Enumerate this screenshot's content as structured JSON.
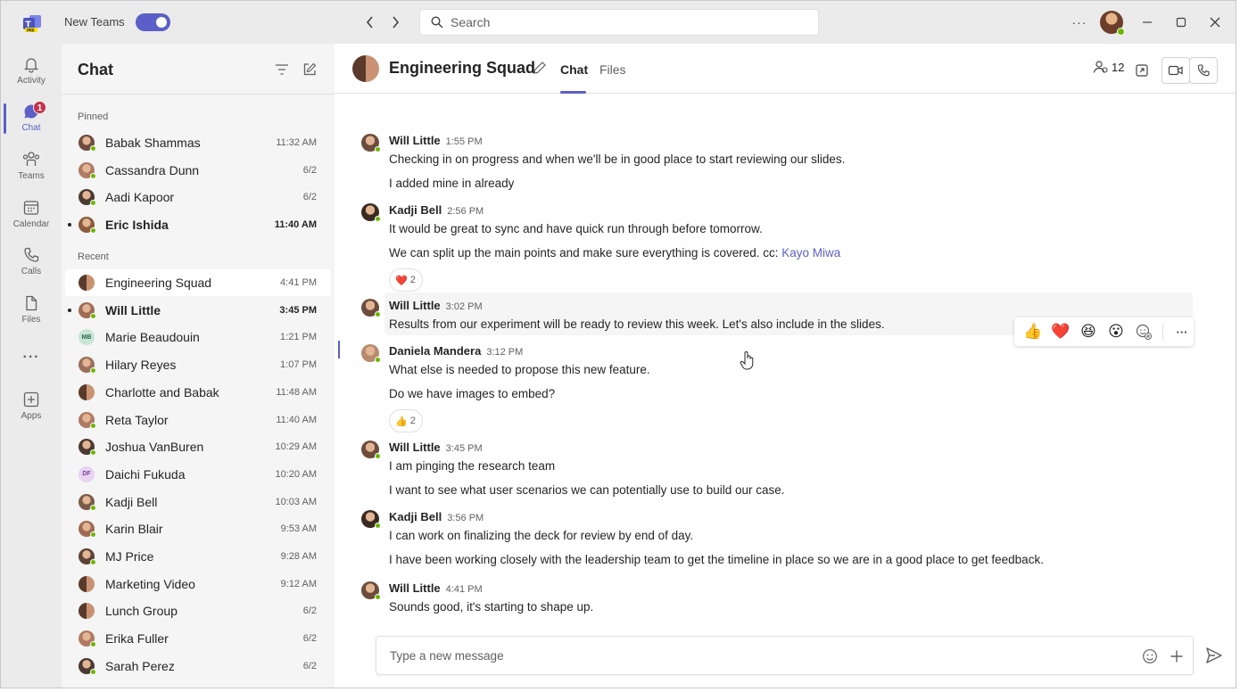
{
  "titlebar": {
    "new_teams_label": "New Teams",
    "search_placeholder": "Search",
    "more_label": "···"
  },
  "rail": {
    "items": [
      {
        "label": "Activity",
        "icon": "bell-icon"
      },
      {
        "label": "Chat",
        "icon": "chat-icon",
        "badge": "1"
      },
      {
        "label": "Teams",
        "icon": "teams-icon"
      },
      {
        "label": "Calendar",
        "icon": "calendar-icon"
      },
      {
        "label": "Calls",
        "icon": "phone-icon"
      },
      {
        "label": "Files",
        "icon": "file-icon"
      },
      {
        "label": "···",
        "icon": "more-icon"
      },
      {
        "label": "Apps",
        "icon": "apps-add-icon"
      }
    ]
  },
  "chatlist": {
    "title": "Chat",
    "pinned_label": "Pinned",
    "recent_label": "Recent",
    "pinned": [
      {
        "name": "Babak Shammas",
        "time": "11:32 AM"
      },
      {
        "name": "Cassandra Dunn",
        "time": "6/2"
      },
      {
        "name": "Aadi Kapoor",
        "time": "6/2"
      },
      {
        "name": "Eric Ishida",
        "time": "11:40 AM",
        "unread": true
      }
    ],
    "recent": [
      {
        "name": "Engineering Squad",
        "time": "4:41 PM",
        "selected": true
      },
      {
        "name": "Will Little",
        "time": "3:45 PM",
        "unread": true
      },
      {
        "name": "Marie Beaudouin",
        "time": "1:21 PM",
        "initials": "MB"
      },
      {
        "name": "Hilary Reyes",
        "time": "1:07 PM"
      },
      {
        "name": "Charlotte and Babak",
        "time": "11:48 AM"
      },
      {
        "name": "Reta Taylor",
        "time": "11:40 AM"
      },
      {
        "name": "Joshua VanBuren",
        "time": "10:29 AM"
      },
      {
        "name": "Daichi Fukuda",
        "time": "10:20 AM",
        "initials": "DF"
      },
      {
        "name": "Kadji Bell",
        "time": "10:03 AM"
      },
      {
        "name": "Karin Blair",
        "time": "9:53 AM"
      },
      {
        "name": "MJ Price",
        "time": "9:28 AM"
      },
      {
        "name": "Marketing Video",
        "time": "9:12 AM"
      },
      {
        "name": "Lunch Group",
        "time": "6/2"
      },
      {
        "name": "Erika Fuller",
        "time": "6/2"
      },
      {
        "name": "Sarah Perez",
        "time": "6/2"
      }
    ]
  },
  "conversation": {
    "title": "Engineering Squad",
    "tabs": [
      "Chat",
      "Files"
    ],
    "participants_count": "12",
    "messages": [
      {
        "author": "Will Little",
        "time": "1:55 PM",
        "lines": [
          "Checking in on progress and when we'll be in good place to start reviewing our slides.",
          "I added mine in already"
        ]
      },
      {
        "author": "Kadji Bell",
        "time": "2:56 PM",
        "lines": [
          "It would be great to sync and have quick run through before tomorrow.",
          "We can split up the main points and make sure everything is covered. cc: "
        ],
        "mention": "Kayo Miwa",
        "reaction": {
          "emoji": "❤️",
          "count": "2"
        }
      },
      {
        "author": "Will Little",
        "time": "3:02 PM",
        "lines": [
          "Results from our experiment will be ready to review this week. Let's also include in the slides."
        ]
      },
      {
        "author": "Daniela Mandera",
        "time": "3:12 PM",
        "lines": [
          "What else is needed to propose this new feature.",
          "Do we have images to embed?"
        ],
        "reaction": {
          "emoji": "👍",
          "count": "2"
        }
      },
      {
        "author": "Will Little",
        "time": "3:45 PM",
        "lines": [
          "I am pinging the research team",
          "I want to see what user scenarios we can potentially use to build our case."
        ]
      },
      {
        "author": "Kadji Bell",
        "time": "3:56 PM",
        "lines": [
          "I can work on finalizing the deck for review by end of day.",
          "I have been working closely with the leadership team to get the timeline in place so we are in a good place to get feedback."
        ]
      },
      {
        "author": "Will Little",
        "time": "4:41 PM",
        "lines": [
          "Sounds good, it's starting to shape up."
        ]
      }
    ],
    "reaction_bar": [
      "👍",
      "❤️",
      "😆",
      "😮",
      "add-reaction-icon",
      "more-icon"
    ],
    "composer_placeholder": "Type a new message"
  }
}
